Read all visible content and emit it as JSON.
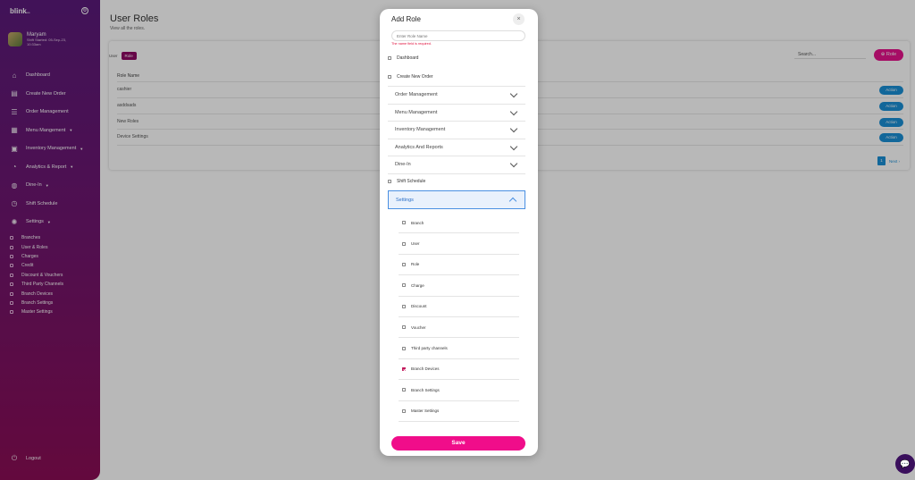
{
  "sidebar": {
    "logo": "blink",
    "logo_suffix": "ios",
    "user_name": "Maryam",
    "shift_text": "Shift Started: 05-Sep-23, 10:33am",
    "items": [
      {
        "label": "Dashboard",
        "icon": "home-icon",
        "caret": false
      },
      {
        "label": "Create New Order",
        "icon": "clipboard-icon",
        "caret": false
      },
      {
        "label": "Order Management",
        "icon": "list-icon",
        "caret": false
      },
      {
        "label": "Menu Mangement",
        "icon": "grid-icon",
        "caret": true
      },
      {
        "label": "Inventory Management",
        "icon": "boxes-icon",
        "caret": true
      },
      {
        "label": "Analytics & Report",
        "icon": "chart-icon",
        "caret": true
      },
      {
        "label": "Dine-In",
        "icon": "dine-icon",
        "caret": true
      },
      {
        "label": "Shift Schedule",
        "icon": "clock-icon",
        "caret": false
      },
      {
        "label": "Settings",
        "icon": "gear-icon",
        "caret": true
      }
    ],
    "sub_items": [
      "Branches",
      "User & Roles",
      "Charges",
      "Credit",
      "Discount & Vouchers",
      "Third Party Channels",
      "Branch Devices",
      "Branch Settings",
      "Master Settings"
    ],
    "logout": "Logout"
  },
  "page": {
    "title": "User Roles",
    "subtitle": "View all the roles.",
    "filter_label": "User",
    "filter_chip": "Role",
    "search_placeholder": "Search...",
    "add_button": "Role",
    "column_header": "Role Name",
    "rows": [
      "cashier",
      "asddsads",
      "New Roles",
      "Device Settings"
    ],
    "action_label": "Action",
    "page_number": "1",
    "next_label": "Next"
  },
  "modal": {
    "title": "Add Role",
    "name_placeholder": "Enter Role Name",
    "name_error": "The name field is required.",
    "top_checks": [
      "Dashboard",
      "Create New Order"
    ],
    "groups": [
      "Order Management",
      "Menu Management",
      "Inventory Management",
      "Analytics And Reports",
      "Dine-In"
    ],
    "shift_schedule": "Shift Schedule",
    "settings_group": "Settings",
    "settings_items": [
      {
        "label": "Branch",
        "checked": false
      },
      {
        "label": "User",
        "checked": false
      },
      {
        "label": "Role",
        "checked": false
      },
      {
        "label": "Charge",
        "checked": false
      },
      {
        "label": "Discount",
        "checked": false
      },
      {
        "label": "Voucher",
        "checked": false
      },
      {
        "label": "Third party channels",
        "checked": false
      },
      {
        "label": "Branch Devices",
        "checked": true
      },
      {
        "label": "Branch Settings",
        "checked": false
      },
      {
        "label": "Master Settings",
        "checked": false
      }
    ],
    "save_label": "Save"
  },
  "colors": {
    "accent": "#f00d8a",
    "sidebar": "#6e1670",
    "action": "#1a8fd6"
  }
}
